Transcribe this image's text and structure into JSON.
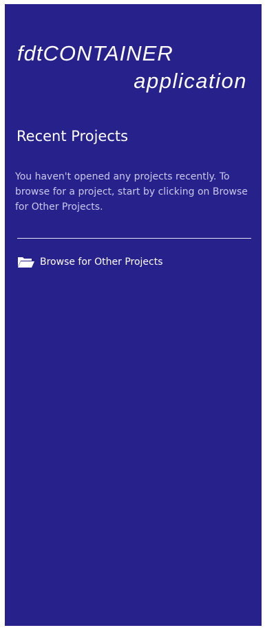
{
  "logo": {
    "line1": "fdtCONTAINER",
    "line2": "application"
  },
  "recent": {
    "title": "Recent Projects",
    "hint": "You haven't opened any projects recently. To browse for a project, start by clicking on Browse for Other Projects."
  },
  "browse": {
    "icon": "folder-open-icon",
    "label": "Browse for Other Projects"
  },
  "colors": {
    "panel_bg": "#27218c",
    "text": "#ffffff",
    "hint_text": "#c9c9ee"
  }
}
